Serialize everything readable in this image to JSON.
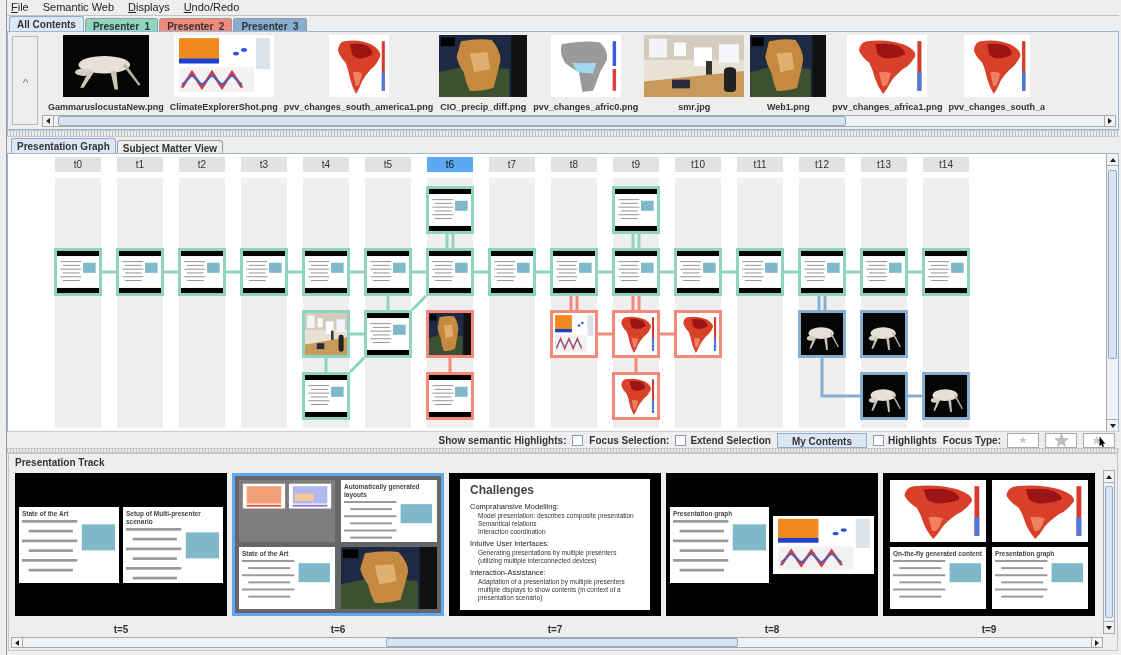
{
  "menu": [
    {
      "label": "File",
      "underline_first": true
    },
    {
      "label": "Semantic Web",
      "underline_first": false
    },
    {
      "label": "Displays",
      "underline_first": true
    },
    {
      "label": "Undo/Redo",
      "underline_first": true
    }
  ],
  "presenter_tabs": [
    {
      "label": "All Contents",
      "selected": true,
      "color": "#dce7f3"
    },
    {
      "label": "Presenter_1",
      "selected": false,
      "color": "#8fd3c1"
    },
    {
      "label": "Presenter_2",
      "selected": false,
      "color": "#f2897a"
    },
    {
      "label": "Presenter_3",
      "selected": false,
      "color": "#86aed0"
    }
  ],
  "contents": [
    {
      "label": "GammaruslocustaNew.png",
      "kind": "picture"
    },
    {
      "label": "ClimateExplorerShot.png",
      "kind": "picture"
    },
    {
      "label": "pvv_changes_south_america1.png",
      "kind": "picture"
    },
    {
      "label": "CIO_precip_diff.png",
      "kind": "picture"
    },
    {
      "label": "pvv_changes_afric0.png",
      "kind": "picture"
    },
    {
      "label": "smr.jpg",
      "kind": "picture"
    },
    {
      "label": "Web1.png",
      "kind": "picture"
    },
    {
      "label": "pvv_changes_africa1.png",
      "kind": "picture"
    },
    {
      "label": "pvv_changes_south_a",
      "kind": "picture"
    }
  ],
  "view_tabs": [
    {
      "label": "Presentation Graph",
      "selected": true
    },
    {
      "label": "Subject Matter View",
      "selected": false
    }
  ],
  "graph": {
    "columns": [
      {
        "label": "t0",
        "selected": false
      },
      {
        "label": "t1",
        "selected": false
      },
      {
        "label": "t2",
        "selected": false
      },
      {
        "label": "t3",
        "selected": false
      },
      {
        "label": "t4",
        "selected": false
      },
      {
        "label": "t5",
        "selected": false
      },
      {
        "label": "t6",
        "selected": true
      },
      {
        "label": "t7",
        "selected": false
      },
      {
        "label": "t8",
        "selected": false
      },
      {
        "label": "t9",
        "selected": false
      },
      {
        "label": "t10",
        "selected": false
      },
      {
        "label": "t11",
        "selected": false
      },
      {
        "label": "t12",
        "selected": false
      },
      {
        "label": "t13",
        "selected": false
      },
      {
        "label": "t14",
        "selected": false
      }
    ],
    "rows": [
      {
        "cells": [
          {
            "kind": "empty"
          },
          {
            "kind": "empty"
          },
          {
            "kind": "empty"
          },
          {
            "kind": "empty"
          },
          {
            "kind": "empty"
          },
          {
            "kind": "empty"
          },
          {
            "kind": "slide",
            "color": "#8fd3c1",
            "links": [
              {
                "kind": "down_double"
              }
            ]
          },
          {
            "kind": "empty"
          },
          {
            "kind": "empty"
          },
          {
            "kind": "slide",
            "color": "#8fd3c1",
            "links": [
              {
                "kind": "down_double"
              }
            ]
          },
          {
            "kind": "empty"
          },
          {
            "kind": "empty"
          },
          {
            "kind": "empty"
          },
          {
            "kind": "empty"
          },
          {
            "kind": "empty"
          }
        ]
      },
      {
        "cells": [
          {
            "kind": "slide",
            "color": "#8fd3c1",
            "links": [
              {
                "kind": "right"
              }
            ]
          },
          {
            "kind": "slide",
            "color": "#8fd3c1",
            "links": [
              {
                "kind": "right"
              }
            ]
          },
          {
            "kind": "slide",
            "color": "#8fd3c1",
            "links": [
              {
                "kind": "right"
              }
            ]
          },
          {
            "kind": "slide",
            "color": "#8fd3c1",
            "links": [
              {
                "kind": "right"
              }
            ]
          },
          {
            "kind": "slide",
            "color": "#8fd3c1",
            "links": [
              {
                "kind": "right"
              }
            ]
          },
          {
            "kind": "slide",
            "color": "#8fd3c1",
            "links": [
              {
                "kind": "right"
              },
              {
                "kind": "down"
              }
            ]
          },
          {
            "kind": "slide",
            "color": "#8fd3c1",
            "links": [
              {
                "kind": "right"
              },
              {
                "kind": "down_left"
              }
            ]
          },
          {
            "kind": "slide",
            "color": "#8fd3c1",
            "links": [
              {
                "kind": "right"
              }
            ]
          },
          {
            "kind": "slide",
            "color": "#8fd3c1",
            "links": [
              {
                "kind": "right"
              },
              {
                "kind": "down_double"
              }
            ]
          },
          {
            "kind": "slide",
            "color": "#8fd3c1",
            "links": [
              {
                "kind": "right"
              },
              {
                "kind": "down_double"
              }
            ]
          },
          {
            "kind": "slide",
            "color": "#8fd3c1",
            "links": [
              {
                "kind": "right"
              }
            ]
          },
          {
            "kind": "slide",
            "color": "#8fd3c1",
            "links": [
              {
                "kind": "right"
              }
            ]
          },
          {
            "kind": "slide",
            "color": "#8fd3c1",
            "links": [
              {
                "kind": "right"
              },
              {
                "kind": "down_double"
              }
            ]
          },
          {
            "kind": "slide",
            "color": "#8fd3c1",
            "links": [
              {
                "kind": "right"
              }
            ]
          },
          {
            "kind": "slide",
            "color": "#8fd3c1"
          }
        ]
      },
      {
        "cells": [
          {
            "kind": "empty"
          },
          {
            "kind": "empty"
          },
          {
            "kind": "empty"
          },
          {
            "kind": "empty"
          },
          {
            "kind": "picture",
            "color": "#8fd3c1",
            "links": [
              {
                "kind": "right"
              },
              {
                "kind": "down"
              }
            ]
          },
          {
            "kind": "slide",
            "color": "#8fd3c1"
          },
          {
            "kind": "picture",
            "color": "#f2897a",
            "links": [
              {
                "kind": "down"
              }
            ]
          },
          {
            "kind": "empty"
          },
          {
            "kind": "picture",
            "color": "#f2897a",
            "links": [
              {
                "kind": "right"
              }
            ]
          },
          {
            "kind": "picture",
            "color": "#f2897a",
            "links": [
              {
                "kind": "right"
              },
              {
                "kind": "down"
              }
            ]
          },
          {
            "kind": "picture",
            "color": "#f2897a"
          },
          {
            "kind": "empty"
          },
          {
            "kind": "picture",
            "color": "#86aed0",
            "links": [
              {
                "kind": "elbow"
              }
            ]
          },
          {
            "kind": "picture",
            "color": "#86aed0"
          },
          {
            "kind": "empty"
          }
        ]
      },
      {
        "cells": [
          {
            "kind": "empty"
          },
          {
            "kind": "empty"
          },
          {
            "kind": "empty"
          },
          {
            "kind": "empty"
          },
          {
            "kind": "slide",
            "color": "#8fd3c1",
            "links": [
              {
                "kind": "up_right"
              }
            ]
          },
          {
            "kind": "empty"
          },
          {
            "kind": "slide",
            "color": "#f2897a"
          },
          {
            "kind": "empty"
          },
          {
            "kind": "empty"
          },
          {
            "kind": "picture",
            "color": "#f2897a"
          },
          {
            "kind": "empty"
          },
          {
            "kind": "empty"
          },
          {
            "kind": "empty"
          },
          {
            "kind": "picture",
            "color": "#86aed0",
            "links": [
              {
                "kind": "right"
              }
            ]
          },
          {
            "kind": "picture",
            "color": "#86aed0"
          }
        ]
      }
    ]
  },
  "toolbar": [
    {
      "kind": "label",
      "text": "Show semantic Highlights:"
    },
    {
      "kind": "checkbox",
      "checked": false
    },
    {
      "kind": "label",
      "text": "Focus Selection:"
    },
    {
      "kind": "checkbox",
      "checked": false,
      "text": "Extend Selection"
    },
    {
      "kind": "button",
      "text": "My Contents"
    },
    {
      "kind": "checkbox",
      "checked": false,
      "text": "Highlights"
    },
    {
      "kind": "label",
      "text": "Focus Type:"
    },
    {
      "kind": "focus_buttons"
    }
  ],
  "track": {
    "title": "Presentation Track",
    "frames": [
      {
        "label": "t=5",
        "selected": false,
        "kind": "pair",
        "panels": [
          {
            "kind": "slide",
            "title": "State of the Art"
          },
          {
            "kind": "slide",
            "title": "Setup of Multi-presenter scenario"
          }
        ]
      },
      {
        "label": "t=6",
        "selected": true,
        "kind": "grid",
        "panels": [
          {
            "kind": "picture"
          },
          {
            "kind": "slide",
            "title": "Automatically generated layouts"
          },
          {
            "kind": "slide",
            "title": "State of the Art"
          },
          {
            "kind": "picture"
          }
        ]
      },
      {
        "label": "t=7",
        "selected": false,
        "kind": "single",
        "panels": [
          {
            "kind": "slide",
            "title": "Challenges",
            "bullets": [
              {
                "text": "Comprahansive Modelling:",
                "items": [
                  "Model presentation: describes composite presentation",
                  "Semantical relations",
                  "Interaction coordination"
                ]
              },
              {
                "text": "Intuitve User Interfaces:",
                "items": [
                  "Generating presentations by multiple presenters",
                  "(utilizing multiple interconnected devices)"
                ]
              },
              {
                "text": "Interaction-Assistance:",
                "items": [
                  "Adaptation of a presentation by multiple presenters",
                  "multiple displays to show contents (in context of a",
                  "presentation scenario)"
                ]
              }
            ]
          }
        ]
      },
      {
        "label": "t=8",
        "selected": false,
        "kind": "pair",
        "panels": [
          {
            "kind": "slide",
            "title": "Presentation graph"
          },
          {
            "kind": "picture"
          }
        ]
      },
      {
        "label": "t=9",
        "selected": false,
        "kind": "grid",
        "panels": [
          {
            "kind": "picture"
          },
          {
            "kind": "picture"
          },
          {
            "kind": "slide",
            "title": "On-the-fly generated content"
          },
          {
            "kind": "slide",
            "title": "Presentation graph"
          }
        ]
      }
    ]
  }
}
